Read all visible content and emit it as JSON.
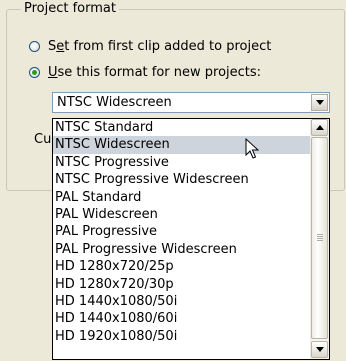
{
  "groupbox": {
    "title": "Project format"
  },
  "options": [
    {
      "underline": "e",
      "before": "S",
      "after": "t from first clip added to project",
      "checked": false
    },
    {
      "underline": "U",
      "before": "",
      "after": "se this format for new projects:",
      "checked": true
    }
  ],
  "combo": {
    "value": "NTSC Widescreen"
  },
  "hidden_label_fragment": "Cu",
  "dropdown": {
    "items": [
      "NTSC Standard",
      "NTSC Widescreen",
      "NTSC Progressive",
      "NTSC Progressive Widescreen",
      "PAL Standard",
      "PAL Widescreen",
      "PAL Progressive",
      "PAL Progressive Widescreen",
      "HD 1280x720/25p",
      "HD 1280x720/30p",
      "HD 1440x1080/50i",
      "HD 1440x1080/60i",
      "HD 1920x1080/50i"
    ],
    "hovered": "NTSC Widescreen"
  },
  "colors": {
    "hover": "#ced4dc",
    "dialog_bg": "#ece9d8",
    "radio_dot": "#21a121"
  },
  "icons": {
    "scroll_up": "arrow-up-icon",
    "scroll_down": "arrow-down-icon",
    "combo_arrow": "chevron-down-icon",
    "pointer": "mouse-pointer-icon"
  }
}
